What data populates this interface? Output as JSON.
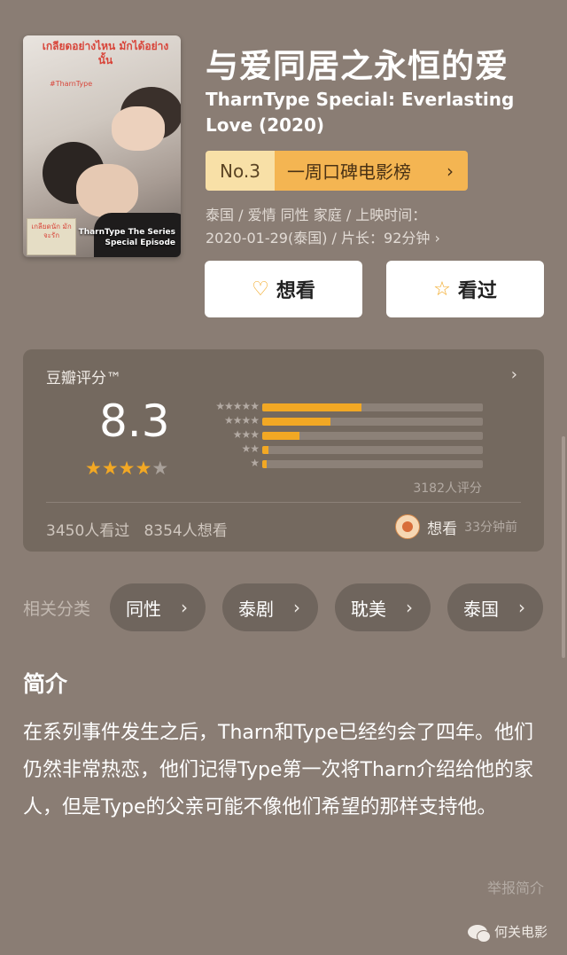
{
  "movie": {
    "title": "与爱同居之永恒的爱",
    "subtitle": "TharnType Special: Everlasting Love (2020)",
    "rank": {
      "no": "No.3",
      "list": "一周口碑电影榜"
    },
    "meta_line1": "泰国 / 爱情 同性 家庭 / 上映时间：",
    "meta_line2": "2020-01-29(泰国) / 片长：92分钟 ›"
  },
  "poster": {
    "top_text": "เกลียดอย่างไหน มักได้อย่างนั้น",
    "sub_text": "#TharnType",
    "caption": "TharnType The Series Special Episode",
    "badge": "เกลียดนัก มักจะรัก"
  },
  "actions": {
    "want_label": "想看",
    "seen_label": "看过"
  },
  "rating": {
    "header": "豆瓣评分™",
    "score": "8.3",
    "stars_filled": 4,
    "stars_total": 5,
    "distribution": [
      {
        "stars": 5,
        "label": "★★★★★",
        "fraction": 0.45
      },
      {
        "stars": 4,
        "label": "★★★★",
        "fraction": 0.31
      },
      {
        "stars": 3,
        "label": "★★★",
        "fraction": 0.17
      },
      {
        "stars": 2,
        "label": "★★",
        "fraction": 0.03
      },
      {
        "stars": 1,
        "label": "★",
        "fraction": 0.02
      }
    ],
    "count": "3182人评分",
    "watched": "3450人看过",
    "wanted": "8354人想看",
    "activity": "想看",
    "activity_time": "33分钟前"
  },
  "categories": {
    "label": "相关分类",
    "items": [
      "同性",
      "泰剧",
      "耽美",
      "泰国"
    ]
  },
  "intro": {
    "heading": "简介",
    "text": "在系列事件发生之后，Tharn和Type已经约会了四年。他们仍然非常热恋，他们记得Type第一次将Tharn介绍给他的家人，但是Type的父亲可能不像他们希望的那样支持他。",
    "report": "举报简介"
  },
  "watermark": "何关电影",
  "colors": {
    "accent": "#f2a824",
    "background": "#8a7d74",
    "card": "#74695f"
  }
}
